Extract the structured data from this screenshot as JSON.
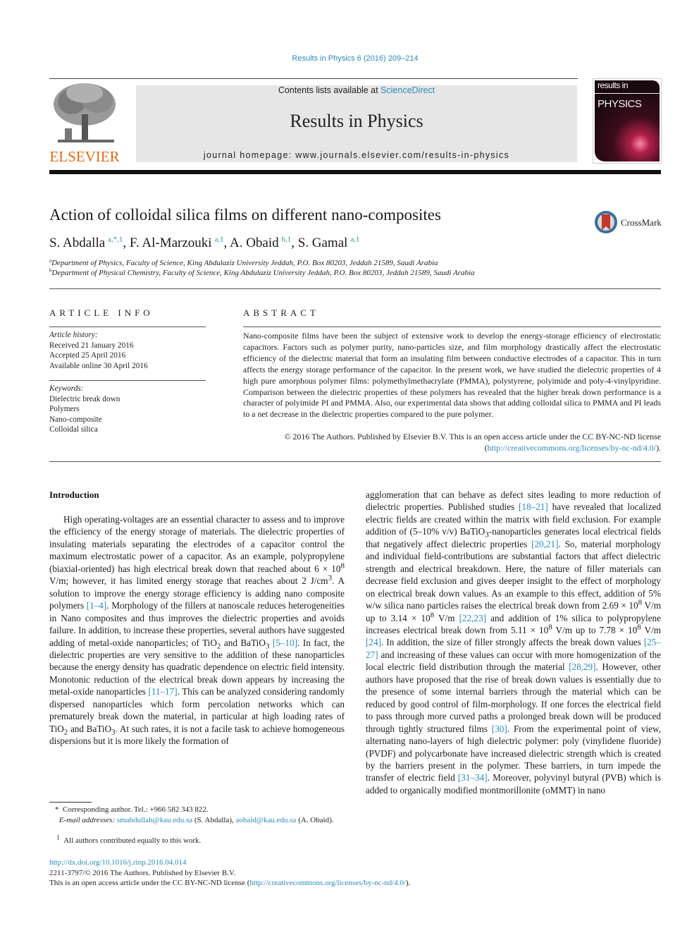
{
  "header": {
    "journal_ref": "Results in Physics 6 (2016) 209–214",
    "contents_prefix": "Contents lists available at ",
    "contents_link": "ScienceDirect",
    "journal_title": "Results in Physics",
    "homepage": "journal homepage: www.journals.elsevier.com/results-in-physics",
    "publisher_logo_text": "ELSEVIER",
    "cover_top": "results in",
    "cover_title": "PHYSICS",
    "crossmark_label": "CrossMark"
  },
  "article": {
    "title": "Action of colloidal silica films on different nano-composites",
    "authors": [
      {
        "name": "S. Abdalla",
        "sup": "a,*,1"
      },
      {
        "name": "F. Al-Marzouki",
        "sup": "a,1"
      },
      {
        "name": "A. Obaid",
        "sup": "b,1"
      },
      {
        "name": "S. Gamal",
        "sup": "a,1"
      }
    ],
    "affiliations": [
      {
        "mark": "a",
        "text": "Department of Physics, Faculty of Science, King Abdulaziz University Jeddah, P.O. Box 80203, Jeddah 21589, Saudi Arabia"
      },
      {
        "mark": "b",
        "text": "Department of Physical Chemistry, Faculty of Science, King Abdulaziz University Jeddah, P.O. Box 80203, Jeddah 21589, Saudi Arabia"
      }
    ]
  },
  "article_info": {
    "heading": "ARTICLE INFO",
    "history_label": "Article history:",
    "received": "Received 21 January 2016",
    "accepted": "Accepted 25 April 2016",
    "online": "Available online 30 April 2016",
    "keywords_label": "Keywords:",
    "keywords": [
      "Dielectric break down",
      "Polymers",
      "Nano-composite",
      "Colloidal silica"
    ]
  },
  "abstract": {
    "heading": "ABSTRACT",
    "text": "Nano-composite films have been the subject of extensive work to develop the energy-storage efficiency of electrostatic capacitors. Factors such as polymer purity, nano-particles size, and film morphology drastically affect the electrostatic efficiency of the dielectric material that form an insulating film between conductive electrodes of a capacitor. This in turn affects the energy storage performance of the capacitor. In the present work, we have studied the dielectric properties of 4 high pure amorphous polymer films: polymethylmethacrylate (PMMA), polystyrene, polyimide and poly-4-vinylpyridine. Comparison between the dielectric properties of these polymers has revealed that the higher break down performance is a character of polyimide PI and PMMA. Also, our experimental data shows that adding colloidal silica to PMMA and PI leads to a net decrease in the dielectric properties compared to the pure polymer.",
    "copyright": "© 2016 The Authors. Published by Elsevier B.V. This is an open access article under the CC BY-NC-ND license (",
    "license_link": "http://creativecommons.org/licenses/by-nc-nd/4.0/",
    "copyright_end": ")."
  },
  "intro": {
    "heading": "Introduction",
    "left": {
      "t1": "High operating-voltages are an essential character to assess and to improve the efficiency of the energy storage of materials. The dielectric properties of insulating materials separating the electrodes of a capacitor control the maximum electrostatic power of a capacitor. As an example, polypropylene (biaxial-oriented) has high electrical break down that reached about 6 × 10",
      "s1": "8",
      "t2": " V/m; however, it has limited energy storage that reaches about 2 J/cm",
      "s2": "3",
      "t3": ". A solution to improve the energy storage efficiency is adding nano composite polymers ",
      "r1": "[1–4]",
      "t4": ". Morphology of the fillers at nanoscale reduces heterogeneities in Nano composites and thus improves the dielectric properties and avoids failure. In addition, to increase these properties, several authors have suggested adding of metal-oxide nanoparticles; of TiO",
      "sub1": "2",
      "t5": " and BaTiO",
      "sub2": "3",
      "t6": " ",
      "r2": "[5–10]",
      "t7": ". In fact, the dielectric properties are very sensitive to the addition of these nanoparticles because the energy density has quadratic dependence on electric field intensity. Monotonic reduction of the electrical break down appears by increasing the metal-oxide nanoparticles ",
      "r3": "[11–17]",
      "t8": ". This can be analyzed considering randomly dispersed nanoparticles which form percolation networks which can prematurely break down the material, in particular at high loading rates of TiO",
      "sub3": "2",
      "t9": " and BaTiO",
      "sub4": "3",
      "t10": ". At such rates, it is not a facile task to achieve homogeneous dispersions but it is more likely the formation of"
    },
    "right": {
      "t1": "agglomeration that can behave as defect sites leading to more reduction of dielectric properties. Published studies ",
      "r1": "[18–21]",
      "t2": " have revealed that localized electric fields are created within the matrix with field exclusion. For example addition of (5–10% v/v) BaTiO",
      "sub1": "3",
      "t3": "-nanoparticles generates local electrical fields that negatively affect dielectric properties ",
      "r2": "[20,21]",
      "t4": ". So, material morphology and individual field-contributions are substantial factors that affect dielectric strength and electrical breakdown. Here, the nature of filler materials can decrease field exclusion and gives deeper insight to the effect of morphology on electrical break down values. As an example to this effect, addition of 5% w/w silica nano particles raises the electrical break down from 2.69 × 10",
      "s1": "8",
      "t5": " V/m up to 3.14 × 10",
      "s2": "8",
      "t6": " V/m ",
      "r3": "[22,23]",
      "t7": " and addition of 1% silica to polypropylene increases electrical break down from 5.11 × 10",
      "s3": "8",
      "t8": " V/m up to 7.78 × 10",
      "s4": "8",
      "t9": " V/m ",
      "r4": "[24]",
      "t10": ". In addition, the size of filler strongly affects the break down values ",
      "r5": "[25–27]",
      "t11": " and increasing of these values can occur with more homogenization of the local electric field distribution through the material ",
      "r6": "[28,29]",
      "t12": ". However, other authors have proposed that the rise of break down values is essentially due to the presence of some internal barriers through the material which can be reduced by good control of film-morphology. If one forces the electrical field to pass through more curved paths a prolonged break down will be produced through tightly structured films ",
      "r7": "[30]",
      "t13": ". From the experimental point of view, alternating nano-layers of high dielectric polymer: poly (vinylidene fluoride) (PVDF) and polycarbonate have increased dielectric strength which is created by the barriers present in the polymer. These barriers, in turn impede the transfer of electric field ",
      "r8": "[31–34]",
      "t14": ". Moreover, polyvinyl butyral (PVB) which is added to organically modified montmorillonite (oMMT) in nano"
    }
  },
  "footnotes": {
    "corresponding": "Corresponding author. Tel.: +966 582 343 822.",
    "corr_mark": "*",
    "email_label": "E-mail addresses:",
    "email1": "smabdullah@kau.edu.sa",
    "email1_name": " (S. Abdalla), ",
    "email2": "aobaid@kau.edu.sa",
    "email2_name": " (A. Obaid).",
    "equal_mark": "1",
    "equal": "All authors contributed equally to this work."
  },
  "bottom": {
    "doi": "http://dx.doi.org/10.1016/j.rinp.2016.04.014",
    "issn": "2211-3797/© 2016 The Authors. Published by Elsevier B.V.",
    "oa_prefix": "This is an open access article under the CC BY-NC-ND license (",
    "oa_link": "http://creativecommons.org/licenses/by-nc-nd/4.0/",
    "oa_suffix": ")."
  }
}
